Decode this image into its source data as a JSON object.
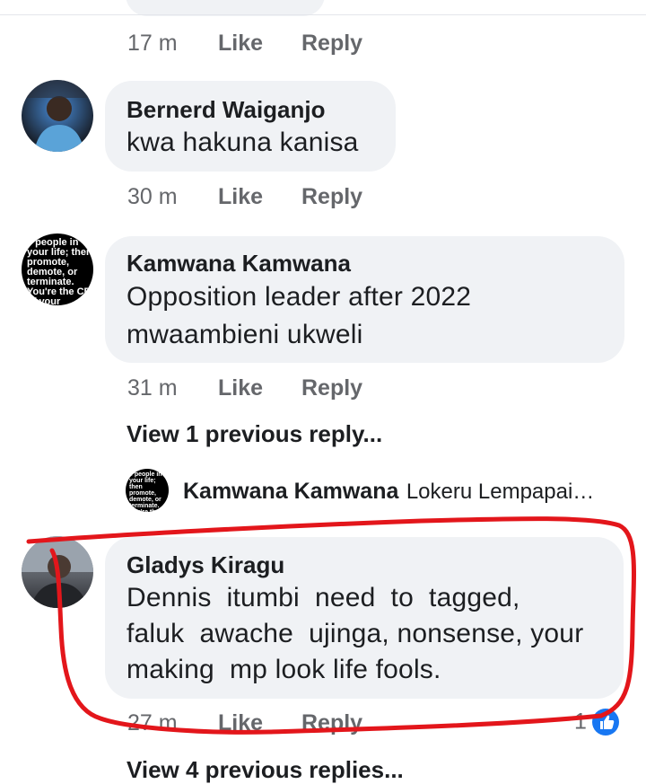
{
  "top_comment": {
    "time": "17 m",
    "like_label": "Like",
    "reply_label": "Reply"
  },
  "comments": [
    {
      "name": "Bernerd Waiganjo",
      "lines": [
        "kwa hakuna kanisa"
      ],
      "time": "30 m",
      "like_label": "Like",
      "reply_label": "Reply"
    },
    {
      "name": "Kamwana Kamwana",
      "lines": [
        "Opposition leader after 2022",
        "mwaambieni ukweli"
      ],
      "time": "31 m",
      "like_label": "Like",
      "reply_label": "Reply",
      "avatar_text": "e people in your life; then promote, demote, or terminate. You're the CEO of your"
    },
    {
      "name": "Gladys Kiragu",
      "lines": [
        "Dennis  itumbi  need  to  tagged,",
        "faluk  awache  ujinga, nonsense, your",
        "making  mp look life fools."
      ],
      "time": "27 m",
      "like_label": "Like",
      "reply_label": "Reply",
      "reaction_count": "1"
    }
  ],
  "view_previous_reply": "View 1 previous reply...",
  "nested_reply": {
    "name": "Kamwana Kamwana",
    "preview": "Lokeru Lempapai…",
    "avatar_text": "e people in your life; then promote, demote, or terminate. You're the CEO of your"
  },
  "view_previous_replies": "View 4 previous replies...",
  "colors": {
    "bubble": "#f0f2f5",
    "meta": "#65676b",
    "annotation": "#e3161b",
    "like_blue": "#1877f2"
  },
  "icons": {
    "like_reaction": "thumbs-up-icon"
  }
}
